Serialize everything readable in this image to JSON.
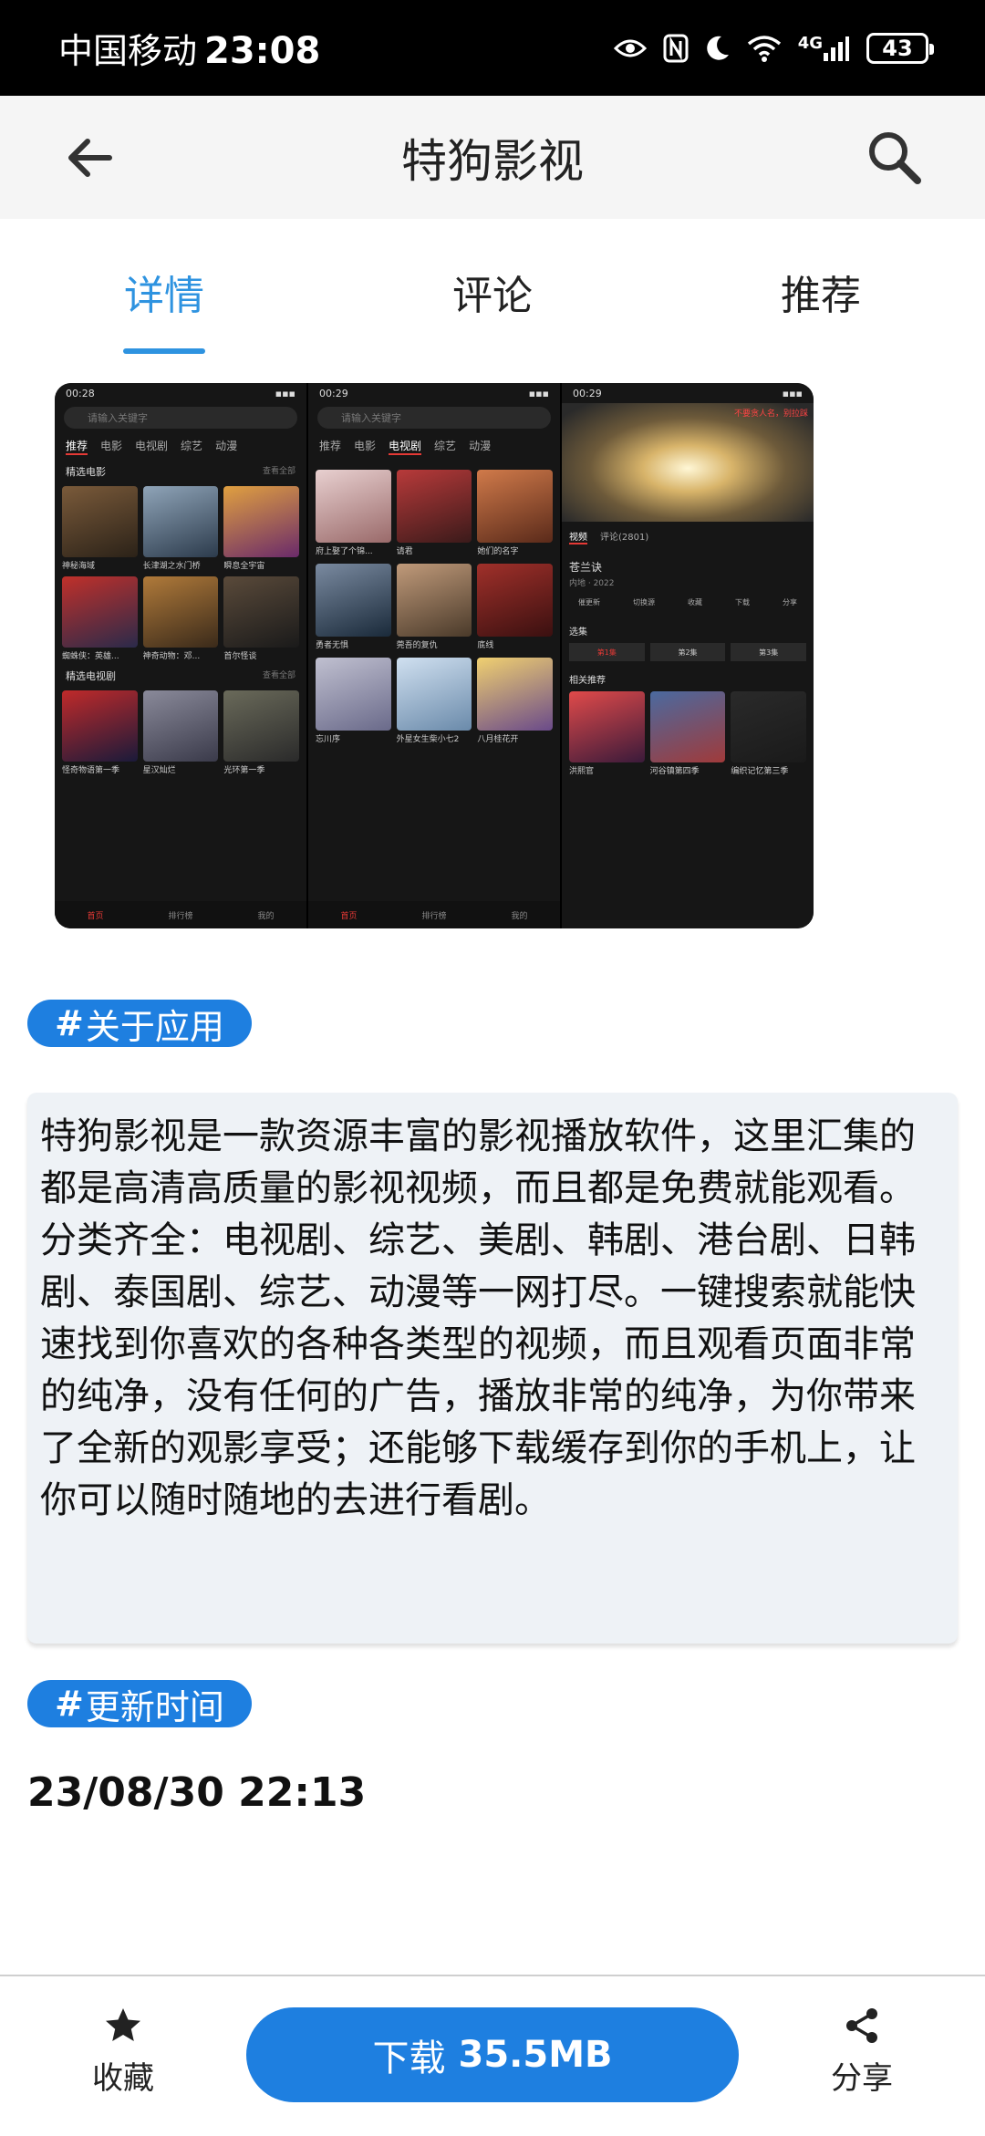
{
  "status_bar": {
    "carrier": "中国移动",
    "time": "23:08",
    "network": "4G",
    "battery": "43"
  },
  "header": {
    "title": "特狗影视",
    "back_icon": "arrow-left-icon",
    "search_icon": "search-icon"
  },
  "tabs": [
    {
      "label": "详情",
      "active": true
    },
    {
      "label": "评论",
      "active": false
    },
    {
      "label": "推荐",
      "active": false
    }
  ],
  "screenshots": {
    "shot1": {
      "time": "00:28",
      "search_placeholder": "请输入关键字",
      "categories": [
        "推荐",
        "电影",
        "电视剧",
        "综艺",
        "动漫"
      ],
      "section1": "精选电影",
      "section2": "精选电视剧",
      "more": "查看全部",
      "movies": [
        "神秘海域",
        "长津湖之水门桥",
        "瞬息全宇宙",
        "蜘蛛侠：英雄...",
        "神奇动物：邓...",
        "首尔怪谈"
      ],
      "tv": [
        "怪奇物语第一季",
        "星汉灿烂",
        "光环第一季"
      ],
      "nav": [
        "首页",
        "排行榜",
        "我的"
      ]
    },
    "shot2": {
      "time": "00:29",
      "search_placeholder": "请输入关键字",
      "categories": [
        "推荐",
        "电影",
        "电视剧",
        "综艺",
        "动漫"
      ],
      "items": [
        "府上娶了个锦...",
        "请君",
        "她们的名字",
        "勇者无惧",
        "莞吾的复仇",
        "底线",
        "忘川序",
        "外星女生柴小七2",
        "八月桂花开"
      ],
      "nav": [
        "首页",
        "排行榜",
        "我的"
      ]
    },
    "shot3": {
      "time": "00:29",
      "notice": "不要贪人名，别拉踩",
      "tabs": [
        "视频",
        "评论(2801)"
      ],
      "title": "苍兰诀",
      "meta": "内地 · 2022",
      "actions": [
        "催更新",
        "切换源",
        "收藏",
        "下载",
        "分享"
      ],
      "episodes_label": "选集",
      "episodes": [
        "第1集",
        "第2集",
        "第3集"
      ],
      "related_label": "相关推荐",
      "related": [
        "洪熙官",
        "河谷镇第四季",
        "编织记忆第三季"
      ]
    }
  },
  "about": {
    "hash": "#",
    "label": "关于应用",
    "text": "特狗影视是一款资源丰富的影视播放软件，这里汇集的都是高清高质量的影视视频，而且都是免费就能观看。分类齐全：电视剧、综艺、美剧、韩剧、港台剧、日韩剧、泰国剧、综艺、动漫等一网打尽。一键搜索就能快速找到你喜欢的各种各类型的视频，而且观看页面非常的纯净，没有任何的广告，播放非常的纯净，为你带来了全新的观影享受；还能够下载缓存到你的手机上，让你可以随时随地的去进行看剧。"
  },
  "update": {
    "hash": "#",
    "label": "更新时间",
    "value": "23/08/30 22:13"
  },
  "bottom_bar": {
    "favorite_label": "收藏",
    "download_label": "下载",
    "download_size": "35.5MB",
    "share_label": "分享"
  },
  "colors": {
    "accent": "#1e7fe0",
    "tab_active": "#2e93e0",
    "status_bar_bg": "#000000",
    "header_bg": "#f5f5f5",
    "desc_bg": "#eef2f6"
  }
}
